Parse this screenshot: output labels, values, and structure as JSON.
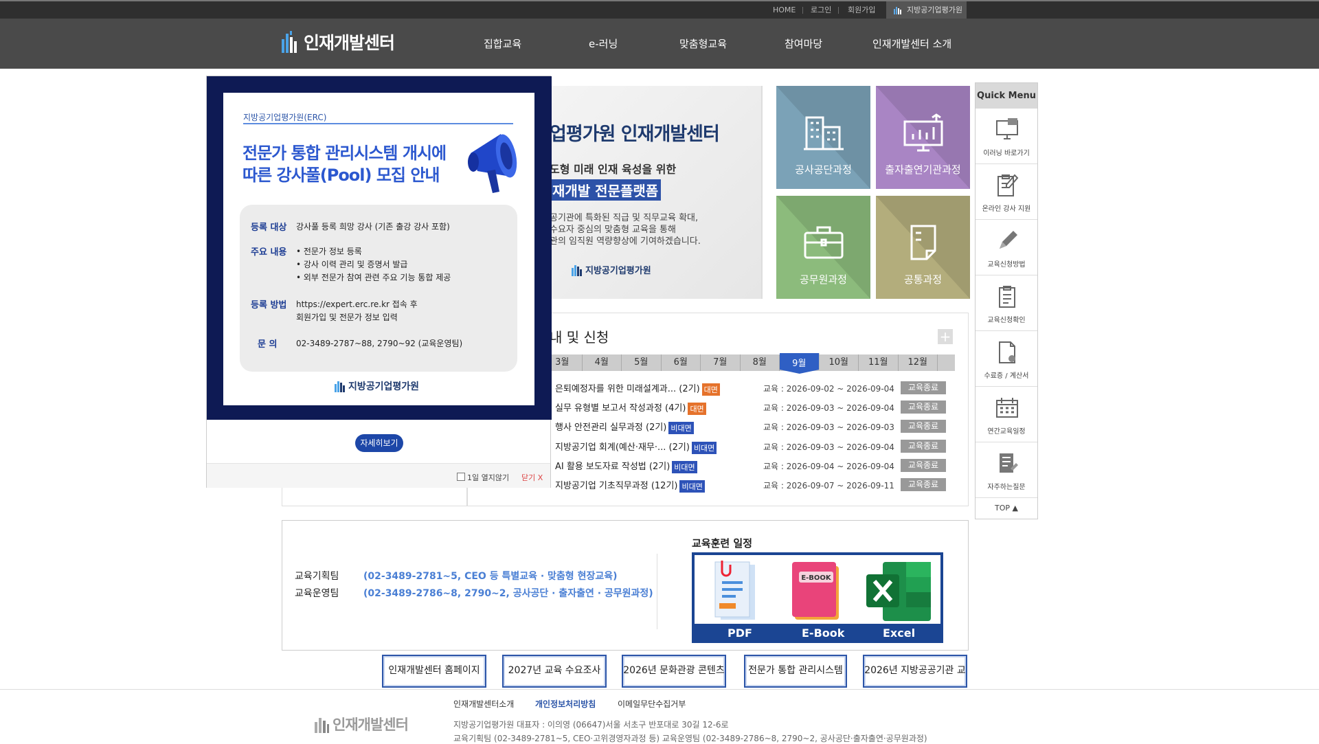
{
  "topbar": {
    "home": "HOME",
    "login": "로그인",
    "signup": "회원가입",
    "org": "지방공기업평가원"
  },
  "gnb": {
    "logo_text": "인재개발센터",
    "menu": [
      "집합교육",
      "e-러닝",
      "맞춤형교육",
      "참여마당",
      "인재개발센터 소개"
    ]
  },
  "hero": {
    "title": "업평가원 인재개발센터",
    "subtitle": "도형 미래 인재 육성을 위한",
    "highlight": "재개발 전문플랫폼",
    "desc": [
      "공기관에 특화된 직급 및 직무교육 확대,",
      "수요자 중심의 맞춤형 교육을 통해",
      "관의 임직원 역량향상에 기여하겠습니다."
    ],
    "org": "지방공기업평가원"
  },
  "tiles": [
    {
      "label": "공사공단과정",
      "color": "#7ba2b7",
      "icon": "building-icon"
    },
    {
      "label": "출자출연기관과정",
      "color": "#a985c4",
      "icon": "chart-icon"
    },
    {
      "label": "공무원과정",
      "color": "#8cbb7c",
      "icon": "briefcase-icon"
    },
    {
      "label": "공통과정",
      "color": "#b3ad7c",
      "icon": "document-icon"
    }
  ],
  "schedule": {
    "title": "내 및 신청",
    "more": "+",
    "months": [
      "3월",
      "4월",
      "5월",
      "6월",
      "7월",
      "8월",
      "9월",
      "10월",
      "11월",
      "12월"
    ],
    "active_month": "9월",
    "courses": [
      {
        "name": "은퇴예정자를 위한 미래설계과... (2기)",
        "badge": "대면",
        "badge_color": "#e5722b",
        "date": "교육 : 2026-09-02 ~ 2026-09-04",
        "status": "교육종료"
      },
      {
        "name": "실무 유형별 보고서 작성과정 (4기)",
        "badge": "대면",
        "badge_color": "#e5722b",
        "date": "교육 : 2026-09-03 ~ 2026-09-04",
        "status": "교육종료"
      },
      {
        "name": "행사 안전관리 실무과정 (2기)",
        "badge": "비대면",
        "badge_color": "#2d52b8",
        "date": "교육 : 2026-09-03 ~ 2026-09-03",
        "status": "교육종료"
      },
      {
        "name": "지방공기업 회계(예산·재무·... (2기)",
        "badge": "비대면",
        "badge_color": "#2d52b8",
        "date": "교육 : 2026-09-03 ~ 2026-09-04",
        "status": "교육종료"
      },
      {
        "name": "AI 활용 보도자료 작성법 (2기)",
        "badge": "비대면",
        "badge_color": "#2d52b8",
        "date": "교육 : 2026-09-04 ~ 2026-09-04",
        "status": "교육종료"
      },
      {
        "name": "지방공기업 기초직무과정 (12기)",
        "badge": "비대면",
        "badge_color": "#2d52b8",
        "date": "교육 : 2026-09-07 ~ 2026-09-11",
        "status": "교육종료"
      }
    ]
  },
  "quick_menu": {
    "title": "Quick Menu",
    "items": [
      {
        "label": "이러닝 바로가기",
        "icon": "monitor-icon"
      },
      {
        "label": "온라인 강사 지원",
        "icon": "clipboard-pen-icon"
      },
      {
        "label": "교육신청방법",
        "icon": "pencil-icon"
      },
      {
        "label": "교육신청확인",
        "icon": "checklist-icon"
      },
      {
        "label": "수료증 / 계산서",
        "icon": "certificate-icon"
      },
      {
        "label": "연간교육일정",
        "icon": "calendar-icon"
      },
      {
        "label": "자주하는질문",
        "icon": "faq-icon"
      }
    ],
    "top": "TOP ▲"
  },
  "contact": {
    "teams": [
      {
        "team": "교육기획팀",
        "info": "(02-3489-2781~5, CEO 등 특별교육 · 맞춤형 현장교육)"
      },
      {
        "team": "교육운영팀",
        "info": "(02-3489-2786~8, 2790~2, 공사공단 · 출자출연 · 공무원과정)"
      }
    ],
    "download_title": "교육훈련 일정",
    "downloads": [
      "PDF",
      "E-Book",
      "Excel"
    ],
    "ebook_cover": "E-BOOK"
  },
  "link_buttons": [
    "인재개발센터 홈페이지",
    "2027년 교육 수요조사",
    "2026년 문화관광 콘텐츠",
    "전문가 통합 관리시스템",
    "2026년 지방공공기관 교"
  ],
  "footer": {
    "links": [
      "인재개발센터소개",
      "개인정보처리방침",
      "이메일무단수집거부"
    ],
    "logo_text": "인재개발센터",
    "address": "지방공기업평가원 대표자 : 이의영 (06647)서울 서초구 반포대로 30길 12-6로",
    "phones": "교육기획팀 (02-3489-2781~5, CEO·고위경영자과정 등)    교육운영팀 (02-3489-2786~8, 2790~2, 공사공단·출자출연·공무원과정)"
  },
  "popup": {
    "org": "지방공기업평가원(ERC)",
    "title1": "전문가 통합 관리시스템 개시에",
    "title2": "따른 강사풀(Pool) 모집 안내",
    "rows": [
      {
        "head": "등록 대상",
        "lines": [
          "강사풀 등록 희망 강사 (기존 출강 강사 포함)"
        ]
      },
      {
        "head": "주요 내용",
        "lines": [
          "•  전문가 정보 등록",
          "•  강사 이력 관리 및 증명서 발급",
          "•  외부 전문가 참여 관련 주요 기능 통합 제공"
        ]
      },
      {
        "head": "등록 방법",
        "lines": [
          "https://expert.erc.re.kr 접속 후",
          "회원가입 및 전문가 정보 입력"
        ]
      },
      {
        "head": "문  의",
        "lines": [
          "02-3489-2787~88, 2790~92 (교육운영팀)"
        ]
      }
    ],
    "card_logo": "지방공기업평가원",
    "more_button": "자세히보기",
    "no_show": "1일 열지않기",
    "close": "닫기 X"
  }
}
